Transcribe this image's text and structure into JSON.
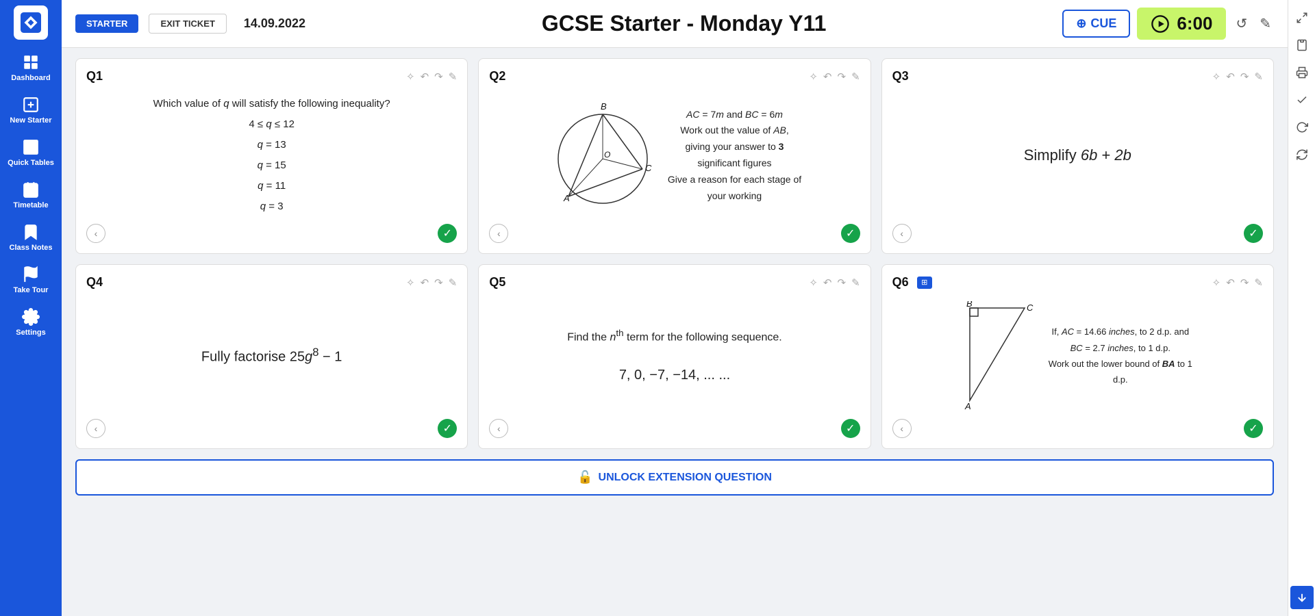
{
  "sidebar": {
    "logo_alt": "logo",
    "items": [
      {
        "id": "dashboard",
        "label": "Dashboard",
        "icon": "grid"
      },
      {
        "id": "new-starter",
        "label": "New Starter",
        "icon": "plus-square"
      },
      {
        "id": "quick-tables",
        "label": "Quick Tables",
        "icon": "table"
      },
      {
        "id": "timetable",
        "label": "Timetable",
        "icon": "calendar"
      },
      {
        "id": "class-notes",
        "label": "Class Notes",
        "icon": "bookmark"
      },
      {
        "id": "take-tour",
        "label": "Take Tour",
        "icon": "flag"
      },
      {
        "id": "settings",
        "label": "Settings",
        "icon": "gear"
      }
    ]
  },
  "header": {
    "btn_starter": "STARTER",
    "btn_exit_ticket": "EXIT TICKET",
    "date": "14.09.2022",
    "title": "GCSE Starter - Monday Y11",
    "btn_cue": "CUE",
    "timer": "6:00"
  },
  "questions": [
    {
      "id": "q1",
      "label": "Q1",
      "type": "multiple-choice",
      "text": "Which value of q will satisfy the following inequality?",
      "math_lines": [
        "4 ≤ q ≤ 12",
        "q = 13",
        "q = 15",
        "q = 11",
        "q = 3"
      ]
    },
    {
      "id": "q2",
      "label": "Q2",
      "type": "diagram",
      "text": "AC = 7m and BC = 6m\nWork out the value of AB, giving your answer to 3 significant figures\nGive a reason for each stage of your working"
    },
    {
      "id": "q3",
      "label": "Q3",
      "type": "simplify",
      "text": "Simplify 6b + 2b"
    },
    {
      "id": "q4",
      "label": "Q4",
      "type": "factorise",
      "text": "Fully factorise 25g⁸ − 1"
    },
    {
      "id": "q5",
      "label": "Q5",
      "type": "sequence",
      "text": "Find the nᵗʰ term for the following sequence.",
      "sequence": "7,  0,  −7,  −14, ... ..."
    },
    {
      "id": "q6",
      "label": "Q6",
      "has_table_icon": true,
      "type": "bounds",
      "text": "If, AC = 14.66 inches, to 2 d.p. and BC = 2.7 inches, to 1 d.p.\nWork out the lower bound of BA to 1 d.p."
    }
  ],
  "extension_btn": "UNLOCK EXTENSION QUESTION",
  "right_panel_icons": [
    "resize",
    "clipboard",
    "print",
    "checkmark",
    "refresh-cw",
    "refresh"
  ],
  "download_btn": "↓"
}
